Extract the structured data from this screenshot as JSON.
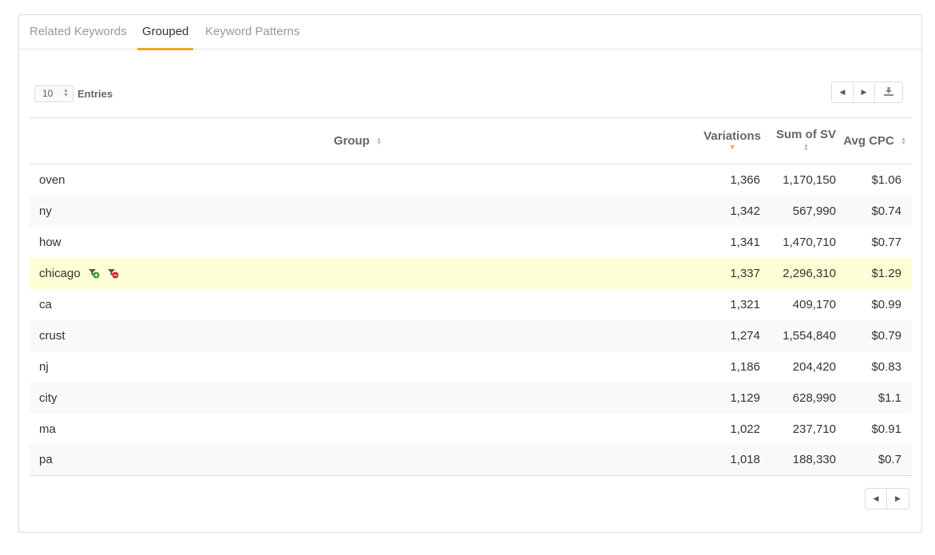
{
  "tabs": [
    "Related Keywords",
    "Grouped",
    "Keyword Patterns"
  ],
  "active_tab": "Grouped",
  "entries": {
    "value": "10",
    "label": "Entries"
  },
  "table": {
    "headers": {
      "group": "Group",
      "variations": "Variations",
      "sum_sv": "Sum of SV",
      "avg_cpc": "Avg CPC"
    },
    "rows": [
      {
        "group": "oven",
        "variations": "1,366",
        "sum_sv": "1,170,150",
        "avg_cpc": "$1.06"
      },
      {
        "group": "ny",
        "variations": "1,342",
        "sum_sv": "567,990",
        "avg_cpc": "$0.74"
      },
      {
        "group": "how",
        "variations": "1,341",
        "sum_sv": "1,470,710",
        "avg_cpc": "$0.77"
      },
      {
        "group": "chicago",
        "variations": "1,337",
        "sum_sv": "2,296,310",
        "avg_cpc": "$1.29"
      },
      {
        "group": "ca",
        "variations": "1,321",
        "sum_sv": "409,170",
        "avg_cpc": "$0.99"
      },
      {
        "group": "crust",
        "variations": "1,274",
        "sum_sv": "1,554,840",
        "avg_cpc": "$0.79"
      },
      {
        "group": "nj",
        "variations": "1,186",
        "sum_sv": "204,420",
        "avg_cpc": "$0.83"
      },
      {
        "group": "city",
        "variations": "1,129",
        "sum_sv": "628,990",
        "avg_cpc": "$1.1"
      },
      {
        "group": "ma",
        "variations": "1,022",
        "sum_sv": "237,710",
        "avg_cpc": "$0.91"
      },
      {
        "group": "pa",
        "variations": "1,018",
        "sum_sv": "188,330",
        "avg_cpc": "$0.7"
      }
    ],
    "highlighted_row": 3,
    "sorted_column": "variations",
    "sort_direction": "desc"
  },
  "icons": {
    "include_filter": "filter-add-icon",
    "exclude_filter": "filter-remove-icon",
    "prev": "chevron-left-icon",
    "next": "chevron-right-icon",
    "download": "download-icon"
  },
  "colors": {
    "accent": "#f5a623",
    "highlight_row": "#fefed6",
    "add": "#2a9d2a",
    "remove": "#d9231d"
  }
}
